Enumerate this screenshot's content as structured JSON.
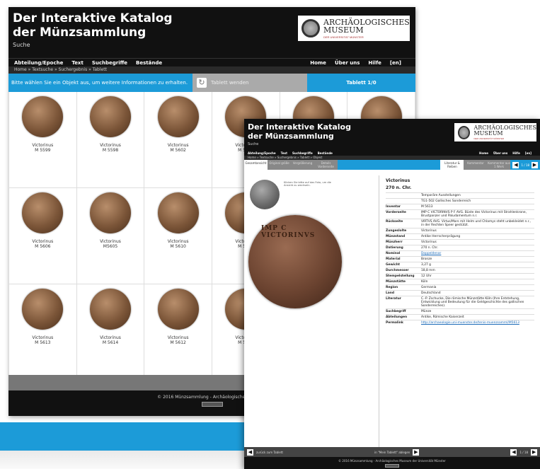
{
  "back_window": {
    "title": "Der Interaktive Katalog der Münzsammlung",
    "logo": {
      "line1": "ARCHÄOLOGISCHES",
      "line2": "MUSEUM",
      "sub": "DER UNIVERSITÄT MÜNSTER"
    },
    "suche": "Suche",
    "nav_left": [
      "Abteilung/Epoche",
      "Text",
      "Suchbegriffe",
      "Bestände"
    ],
    "nav_right": [
      "Home",
      "Über uns",
      "Hilfe",
      "[en]"
    ],
    "breadcrumb": "Home » Textsuche » Suchergebnis » Tablett",
    "info_msg": "Bitte wählen Sie ein Objekt aus, um weitere Informationen zu erhalten.",
    "turn_label": "Tablett wenden",
    "tab_label": "Tablett 1/0",
    "coins": [
      {
        "name": "Victorinus",
        "id": "M 5599"
      },
      {
        "name": "Victorinus",
        "id": "M 5598"
      },
      {
        "name": "Victorinus",
        "id": "M 5602"
      },
      {
        "name": "Victorinus",
        "id": "M 5601"
      },
      {
        "name": "",
        "id": ""
      },
      {
        "name": "",
        "id": ""
      },
      {
        "name": "Victorinus",
        "id": "M 5606"
      },
      {
        "name": "Victorinus",
        "id": "M5605"
      },
      {
        "name": "Victorinus",
        "id": "M 5610"
      },
      {
        "name": "Victorinus",
        "id": "M 5611"
      },
      {
        "name": "",
        "id": ""
      },
      {
        "name": "",
        "id": ""
      },
      {
        "name": "Victorinus",
        "id": "M 5613"
      },
      {
        "name": "Victorinus",
        "id": "M 5614"
      },
      {
        "name": "Victorinus",
        "id": "M 5612"
      },
      {
        "name": "Victorinus",
        "id": "M 5615"
      },
      {
        "name": "",
        "id": ""
      },
      {
        "name": "",
        "id": ""
      }
    ],
    "footer": "© 2016 Münzsammlung - Archäologisches Museum"
  },
  "front_window": {
    "title": "Der Interaktive Katalog der Münzsammlung",
    "logo": {
      "line1": "ARCHÄOLOGISCHES",
      "line2": "MUSEUM",
      "sub": "DER UNIVERSITÄT MÜNSTER"
    },
    "suche": "Suche",
    "nav_left": [
      "Abteilung/Epoche",
      "Text",
      "Suchbegriffe",
      "Bestände"
    ],
    "nav_right": [
      "Home",
      "Über uns",
      "Hilfe",
      "[en]"
    ],
    "breadcrumb": "Home » Textsuche » Suchergebnis » Tablett » Objekt",
    "tabs": [
      "Gesamtansicht",
      "Original größe",
      "Vergrößerung",
      "Details Vorderseite",
      "Literatur & Reiben",
      "Kommentar",
      "Kommentar aus 1 Werk"
    ],
    "pager": "1 / 18",
    "hint": "Klicken Sie bitte auf das Foto, um die Ansicht zu wechseln.",
    "coin_legend": "IMP C VICTORINVS",
    "obj_title": "Victorinus",
    "obj_date": "270 n. Chr.",
    "rows": [
      {
        "k": "",
        "v": "Temporäre Ausstellungen"
      },
      {
        "k": "",
        "v": "TG1-502 Gallisches Sonderreich"
      },
      {
        "k": "Inventar",
        "v": "M 5613"
      },
      {
        "k": "Vorderseite",
        "v": "IMP C VICTORINVS P F AVG. Büste des Victorinus mit Strahlenkrone, Brustpanzer und Paludamentum n.r."
      },
      {
        "k": "Rückseite",
        "v": "VIRTVS AVG. Virtus/Mars mit Helm und Chlamys steht unbekleidet n.r., in der Rechten Speer gestützt."
      },
      {
        "k": "Zungeslolte",
        "v": "Victorinus"
      },
      {
        "k": "Münzstand",
        "v": "Antike Herrscherprägung"
      },
      {
        "k": "Münzherr",
        "v": "Victorinus"
      },
      {
        "k": "Datierung",
        "v": "270 n. Chr."
      },
      {
        "k": "Nominal",
        "v": "Doppeldenar"
      },
      {
        "k": "Material",
        "v": "Bronze"
      },
      {
        "k": "Gewicht",
        "v": "3,27 g"
      },
      {
        "k": "Durchmesser",
        "v": "18,8 mm"
      },
      {
        "k": "Stempelstellung",
        "v": "12 Uhr"
      },
      {
        "k": "Münzstätte",
        "v": "Köln"
      },
      {
        "k": "Region",
        "v": "Germania"
      },
      {
        "k": "Land",
        "v": "Deutschland"
      },
      {
        "k": "Literatur",
        "v": "C.-P. Zschucke, Die römische Münzstätte Köln (Ihre Entstehung, Entwicklung und Bedeutung für die Geldgeschichte des gallischen Sonderreiches)."
      },
      {
        "k": "Suchbegriff",
        "v": "Münze"
      },
      {
        "k": "Abteilungen",
        "v": "Antike, Römische Kaiserzeit"
      },
      {
        "k": "Permalink",
        "v": "http://archaeologie.uni-muenster.de/tenis-muenzsamml/M5613"
      }
    ],
    "back_link": "zurück zum Tablett",
    "add_link": "in \"Mein Tablett\" ablegen",
    "pager_bottom": "1 / 18",
    "footer": "© 2016 Münzsammlung - Archäologisches Museum der Universität Münster"
  }
}
